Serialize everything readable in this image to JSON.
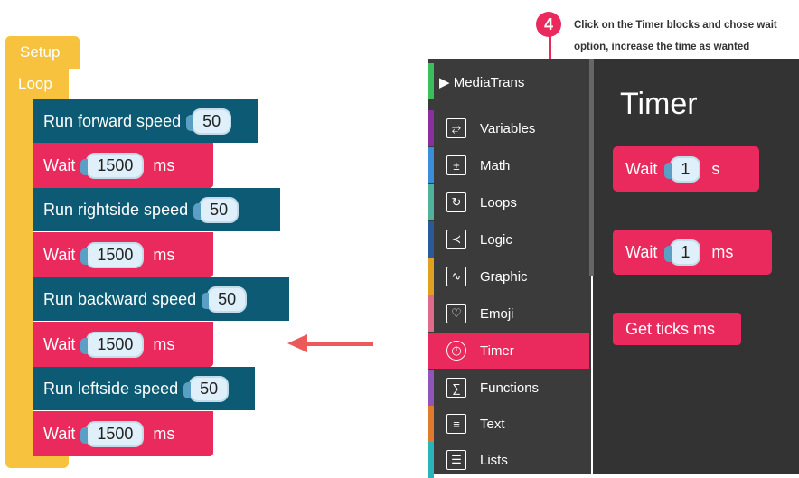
{
  "program": {
    "setup_label": "Setup",
    "loop_label": "Loop",
    "blocks": [
      {
        "type": "run",
        "text": "Run forward speed",
        "value": "50"
      },
      {
        "type": "wait",
        "text": "Wait",
        "value": "1500",
        "unit": "ms"
      },
      {
        "type": "run",
        "text": "Run rightside speed",
        "value": "50"
      },
      {
        "type": "wait",
        "text": "Wait",
        "value": "1500",
        "unit": "ms"
      },
      {
        "type": "run",
        "text": "Run backward speed",
        "value": "50"
      },
      {
        "type": "wait",
        "text": "Wait",
        "value": "1500",
        "unit": "ms"
      },
      {
        "type": "run",
        "text": "Run leftside speed",
        "value": "50"
      },
      {
        "type": "wait",
        "text": "Wait",
        "value": "1500",
        "unit": "ms"
      }
    ]
  },
  "annotation": {
    "step": "4",
    "line1": "Click on the Timer blocks and chose wait",
    "line2": "option, increase the time as wanted"
  },
  "toolbox": {
    "title": "MediaTrans",
    "items": [
      {
        "label": "Variables",
        "color": "#8a2f9e",
        "icon": "variables-icon",
        "glyph": "⥂"
      },
      {
        "label": "Math",
        "color": "#3a8ddb",
        "icon": "math-icon",
        "glyph": "±"
      },
      {
        "label": "Loops",
        "color": "#4fb39c",
        "icon": "loops-icon",
        "glyph": "↻"
      },
      {
        "label": "Logic",
        "color": "#2b5a9c",
        "icon": "logic-icon",
        "glyph": "≺"
      },
      {
        "label": "Graphic",
        "color": "#e0a020",
        "icon": "graphic-icon",
        "glyph": "∿"
      },
      {
        "label": "Emoji",
        "color": "#e06a8a",
        "icon": "emoji-icon",
        "glyph": "♡"
      },
      {
        "label": "Timer",
        "color": "#ea2a5c",
        "icon": "timer-icon",
        "glyph": "◴",
        "selected": true
      },
      {
        "label": "Functions",
        "color": "#8f55b8",
        "icon": "functions-icon",
        "glyph": "∑"
      },
      {
        "label": "Text",
        "color": "#e07a2c",
        "icon": "text-icon",
        "glyph": "≡"
      },
      {
        "label": "Lists",
        "color": "#2ab3b8",
        "icon": "lists-icon",
        "glyph": "☰"
      }
    ]
  },
  "flyout": {
    "title": "Timer",
    "blocks": [
      {
        "text": "Wait",
        "value": "1",
        "unit": "s"
      },
      {
        "text": "Wait",
        "value": "1",
        "unit": "ms"
      },
      {
        "text": "Get ticks ms"
      }
    ]
  }
}
